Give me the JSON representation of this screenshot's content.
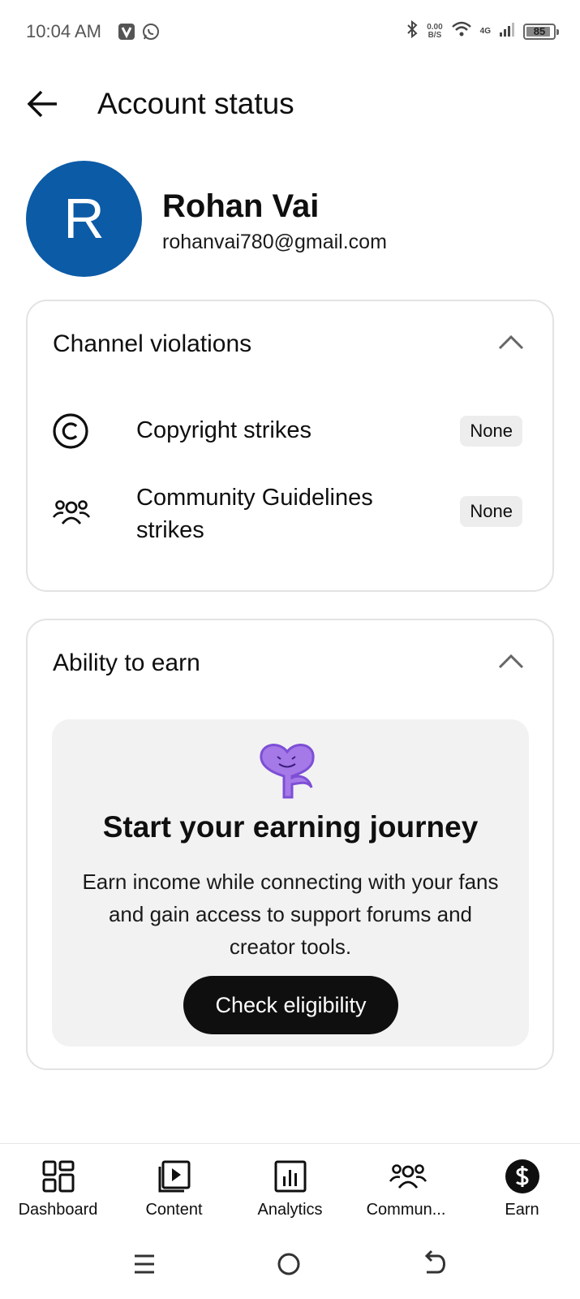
{
  "status_bar": {
    "time": "10:04 AM",
    "net_speed_value": "0.00",
    "net_speed_unit": "B/S",
    "network_type": "4G",
    "battery": "85"
  },
  "header": {
    "title": "Account status"
  },
  "profile": {
    "initial": "R",
    "name": "Rohan Vai",
    "email": "rohanvai780@gmail.com",
    "avatar_color": "#0c5ba6"
  },
  "channel_violations": {
    "title": "Channel violations",
    "items": [
      {
        "label": "Copyright strikes",
        "status": "None",
        "icon": "copyright-icon"
      },
      {
        "label_line1": "Community Guidelines",
        "label_line2": "strikes",
        "status": "None",
        "icon": "community-icon"
      }
    ]
  },
  "earn": {
    "title": "Ability to earn",
    "promo_title": "Start your earning journey",
    "promo_body": "Earn income while connecting with your fans and gain access to support forums and creator tools.",
    "cta_label": "Check eligibility",
    "mascot_color": "#a57ae8"
  },
  "bottom_nav": {
    "items": [
      {
        "label": "Dashboard",
        "icon": "dashboard-icon"
      },
      {
        "label": "Content",
        "icon": "content-icon"
      },
      {
        "label": "Analytics",
        "icon": "analytics-icon"
      },
      {
        "label": "Commun...",
        "icon": "community-icon"
      },
      {
        "label": "Earn",
        "icon": "earn-icon"
      }
    ]
  }
}
